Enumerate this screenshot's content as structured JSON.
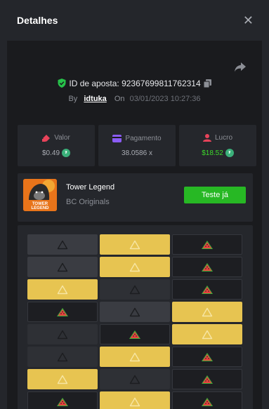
{
  "header": {
    "title": "Detalhes"
  },
  "bet": {
    "id_label": "ID de aposta: 92367699811762314",
    "by_label": "By",
    "user": "idtuka",
    "on_label": "On",
    "date": "03/01/2023 10:27:36"
  },
  "stats": {
    "valor": {
      "label": "Valor",
      "value": "$0.49"
    },
    "pagamento": {
      "label": "Pagamento",
      "value": "38.0586 x"
    },
    "lucro": {
      "label": "Lucro",
      "value": "$18.52"
    }
  },
  "game": {
    "name": "Tower Legend",
    "provider": "BC Originals",
    "play_label": "Teste já",
    "thumb_text": "TOWER LEGEND"
  },
  "grid": {
    "rows": [
      [
        "mine",
        "gem",
        "melon"
      ],
      [
        "mine",
        "gem",
        "melon"
      ],
      [
        "gem",
        "fade",
        "melon"
      ],
      [
        "melon",
        "mine",
        "gem"
      ],
      [
        "fade",
        "melon",
        "gem"
      ],
      [
        "fade",
        "gem",
        "melon"
      ],
      [
        "gem",
        "fade",
        "melon"
      ],
      [
        "melon",
        "gem",
        "melon"
      ]
    ]
  },
  "colors": {
    "accent_green": "#27b824",
    "gem_yellow": "#e7c451",
    "profit_green": "#3dd92b"
  }
}
